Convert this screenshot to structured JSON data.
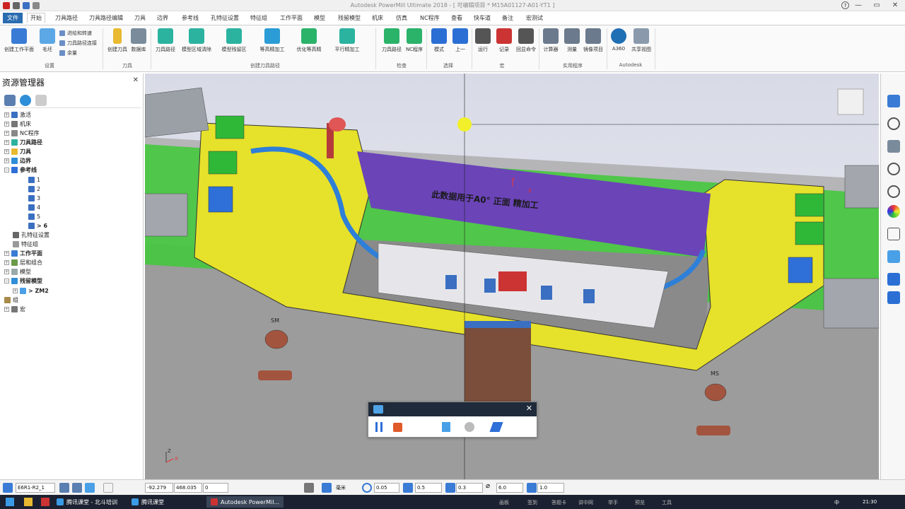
{
  "window": {
    "title": "Autodesk PowerMill Ultimate 2018  -  [ 可编辑项目 * M15A01127-A01-YT1 ]"
  },
  "menu_tabs": [
    "文件",
    "开始",
    "刀具路径",
    "刀具路径编辑",
    "刀具",
    "边界",
    "参考线",
    "孔特征设置",
    "特征组",
    "工作平面",
    "模型",
    "残留模型",
    "机床",
    "仿真",
    "NC程序",
    "查看",
    "快车道",
    "备注",
    "宏测试"
  ],
  "ribbon": {
    "buttons": [
      {
        "label": "创建工作平面",
        "icon": "workplane-icon",
        "color": "#3a7bd5"
      },
      {
        "label": "毛坯",
        "icon": "block-icon",
        "color": "#5ca7e6"
      },
      {
        "label": "创建刀具",
        "icon": "tool-icon",
        "color": "#e8b931"
      },
      {
        "label": "数据库",
        "icon": "database-icon",
        "color": "#7a8b9c"
      },
      {
        "label": "刀具路径",
        "icon": "toolpath-icon",
        "color": "#2bb3a0"
      },
      {
        "label": "模型区域清除",
        "icon": "area-clear-icon",
        "color": "#2bb3a0"
      },
      {
        "label": "模型残留区",
        "icon": "rest-area-icon",
        "color": "#2bb3a0"
      },
      {
        "label": "等高精加工",
        "icon": "constant-z-icon",
        "color": "#2b9cd5"
      },
      {
        "label": "优化等高精",
        "icon": "optimised-z-icon",
        "color": "#2bb36a"
      },
      {
        "label": "平行精加工",
        "icon": "raster-icon",
        "color": "#2bb3a0"
      },
      {
        "label": "刀具路径",
        "icon": "check-toolpath-icon",
        "color": "#2bb36a"
      },
      {
        "label": "NC程序",
        "icon": "check-nc-icon",
        "color": "#2bb36a"
      },
      {
        "label": "模式",
        "icon": "select-mode-icon",
        "color": "#2b6fd5"
      },
      {
        "label": "上一",
        "icon": "previous-icon",
        "color": "#2b6fd5"
      },
      {
        "label": "运行",
        "icon": "run-macro-icon",
        "color": "#555"
      },
      {
        "label": "记录",
        "icon": "record-macro-icon",
        "color": "#c33"
      },
      {
        "label": "回显命令",
        "icon": "echo-icon",
        "color": "#555"
      },
      {
        "label": "计算器",
        "icon": "calculator-icon",
        "color": "#6b7a8c"
      },
      {
        "label": "测量",
        "icon": "measure-icon",
        "color": "#6b7a8c"
      },
      {
        "label": "镜像项目",
        "icon": "mirror-icon",
        "color": "#6b7a8c"
      },
      {
        "label": "A360",
        "icon": "a360-icon",
        "color": "#1f6fb5"
      },
      {
        "label": "共享视图",
        "icon": "share-view-icon",
        "color": "#8a9aac"
      }
    ],
    "small_items": [
      "进给和转速",
      "刀具路径连接",
      "余量"
    ],
    "groups": [
      "设置",
      "刀具",
      "创建刀具路径",
      "检查",
      "选择",
      "宏",
      "实用程序",
      "Autodesk"
    ]
  },
  "explorer": {
    "title": "资源管理器",
    "items": [
      {
        "label": "激活",
        "bold": false
      },
      {
        "label": "机床",
        "bold": false
      },
      {
        "label": "NC程序",
        "bold": false
      },
      {
        "label": "刀具路径",
        "bold": true
      },
      {
        "label": "刀具",
        "bold": true
      },
      {
        "label": "边界",
        "bold": true
      },
      {
        "label": "参考线",
        "bold": true
      },
      {
        "label": "1",
        "bold": false
      },
      {
        "label": "2",
        "bold": false
      },
      {
        "label": "3",
        "bold": false
      },
      {
        "label": "4",
        "bold": false
      },
      {
        "label": "5",
        "bold": false
      },
      {
        "label": "> 6",
        "bold": true
      },
      {
        "label": "孔特征设置",
        "bold": false
      },
      {
        "label": "特征组",
        "bold": false
      },
      {
        "label": "工作平面",
        "bold": true
      },
      {
        "label": "层和组合",
        "bold": false
      },
      {
        "label": "模型",
        "bold": false
      },
      {
        "label": "残留模型",
        "bold": true
      },
      {
        "label": "> ZM2",
        "bold": true
      },
      {
        "label": "组",
        "bold": false
      },
      {
        "label": "宏",
        "bold": false
      }
    ]
  },
  "viewport": {
    "part_text": "此数据用于A0° 正面 精加工",
    "marks": [
      "SM",
      "MS"
    ],
    "axis": {
      "x": "X",
      "y": "Y",
      "z": "Z"
    }
  },
  "recorder": {
    "close": "✕"
  },
  "status": {
    "workplane": "E6R1-R2_1",
    "x": "-92.279",
    "y": "468.035",
    "z": "0",
    "unit": "毫米",
    "tol": "0.05",
    "thick": "0.5",
    "tool_dia": "0.3",
    "diameter": "6.0",
    "stepover": "1.0"
  },
  "taskbar": {
    "apps": [
      "腾讯课堂 - 北斗培训",
      "腾讯课堂",
      "Autodesk PowerMil..."
    ],
    "tray": [
      "画板",
      "签到",
      "答题卡",
      "讲中网",
      "举手",
      "预览",
      "工具"
    ],
    "lang": "中",
    "clock": "21:30"
  }
}
